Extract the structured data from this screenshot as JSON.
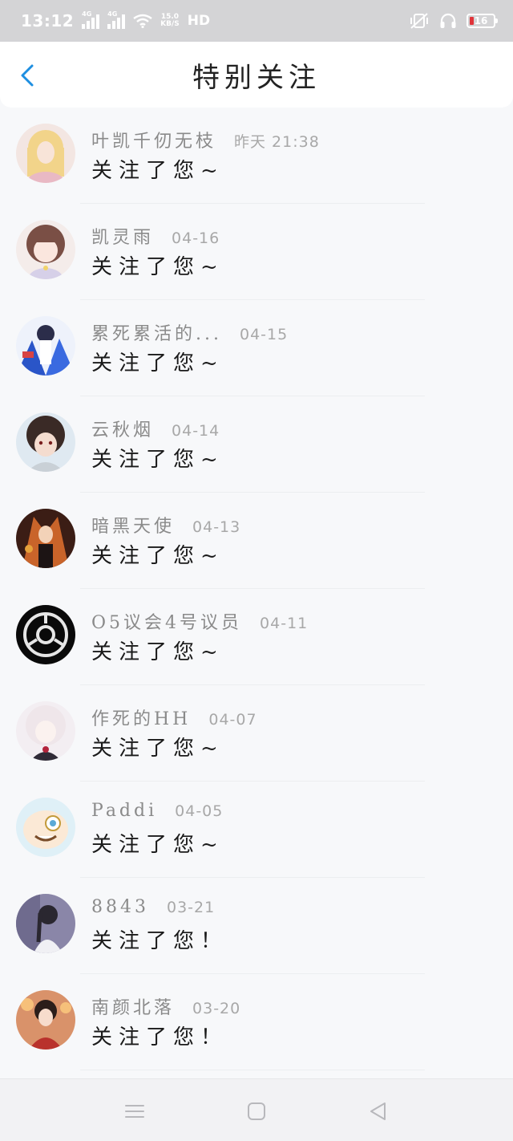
{
  "status_bar": {
    "time": "13:12",
    "network1": "4G",
    "network2": "4G",
    "speed_value": "15.0",
    "speed_unit": "KB/S",
    "hd": "HD",
    "battery": "16"
  },
  "header": {
    "title": "特别关注"
  },
  "items": [
    {
      "name": "叶凯千仞无枝",
      "time": "昨天 21:38",
      "message": "关注了您~"
    },
    {
      "name": "凯灵雨",
      "time": "04-16",
      "message": "关注了您~"
    },
    {
      "name": "累死累活的...",
      "time": "04-15",
      "message": "关注了您~"
    },
    {
      "name": "云秋烟",
      "time": "04-14",
      "message": "关注了您~"
    },
    {
      "name": "暗黑天使",
      "time": "04-13",
      "message": "关注了您~"
    },
    {
      "name": "O5议会4号议员",
      "time": "04-11",
      "message": "关注了您~"
    },
    {
      "name": "作死的HH",
      "time": "04-07",
      "message": "关注了您~"
    },
    {
      "name": "Paddi",
      "time": "04-05",
      "message": "关注了您~"
    },
    {
      "name": "8843",
      "time": "03-21",
      "message": "关注了您！"
    },
    {
      "name": "南颜北落",
      "time": "03-20",
      "message": "关注了您！"
    }
  ],
  "colors": {
    "accent": "#1e8fe1",
    "status_bar": "#d4d4d6"
  }
}
